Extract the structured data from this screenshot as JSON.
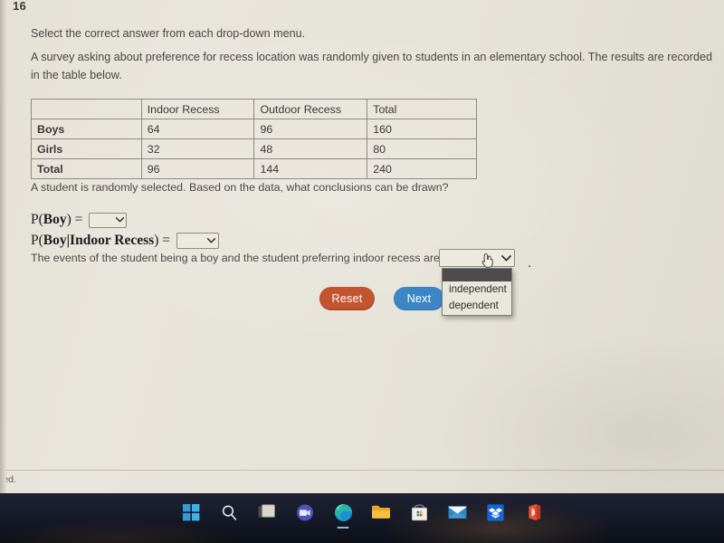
{
  "question": {
    "number": "16",
    "instruction": "Select the correct answer from each drop-down menu.",
    "prompt": "A survey asking about preference for recess location was randomly given to students in an elementary school. The results are recorded in the table below.",
    "subquestion": "A student is randomly selected. Based on the data, what conclusions can be drawn?"
  },
  "table": {
    "corner": "",
    "columns": [
      "Indoor Recess",
      "Outdoor Recess",
      "Total"
    ],
    "rows": [
      {
        "label": "Boys",
        "cells": [
          "64",
          "96",
          "160"
        ]
      },
      {
        "label": "Girls",
        "cells": [
          "32",
          "48",
          "80"
        ]
      },
      {
        "label": "Total",
        "cells": [
          "96",
          "144",
          "240"
        ]
      }
    ]
  },
  "math": {
    "line1_prefix": "P(",
    "line1_event": "Boy",
    "line1_suffix": ") =",
    "line2_prefix": "P(",
    "line2_event": "Boy|Indoor Recess",
    "line2_suffix": ") =",
    "dropdown1_value": "",
    "dropdown2_value": ""
  },
  "conclusion": {
    "text": "The events of the student being a boy and the student preferring indoor recess are",
    "dropdown_value": "",
    "period": ".",
    "options": [
      "independent",
      "dependent"
    ]
  },
  "buttons": {
    "reset": "Reset",
    "next": "Next"
  },
  "footer": {
    "text": "ved."
  },
  "taskbar": {
    "items": [
      {
        "name": "start-icon",
        "label": "Start"
      },
      {
        "name": "search-icon",
        "label": "Search"
      },
      {
        "name": "task-view-icon",
        "label": "Task View"
      },
      {
        "name": "teams-icon",
        "label": "Microsoft Teams"
      },
      {
        "name": "edge-icon",
        "label": "Microsoft Edge"
      },
      {
        "name": "file-explorer-icon",
        "label": "File Explorer"
      },
      {
        "name": "microsoft-store-icon",
        "label": "Microsoft Store"
      },
      {
        "name": "mail-icon",
        "label": "Mail"
      },
      {
        "name": "dropbox-icon",
        "label": "Dropbox"
      },
      {
        "name": "office-icon",
        "label": "Office"
      }
    ]
  },
  "colors": {
    "page_background": "#e5e2d8",
    "reset_button": "#c2542f",
    "next_button": "#3d86c6",
    "dropdown_header": "#4b4b4b",
    "taskbar": "#161a28"
  }
}
